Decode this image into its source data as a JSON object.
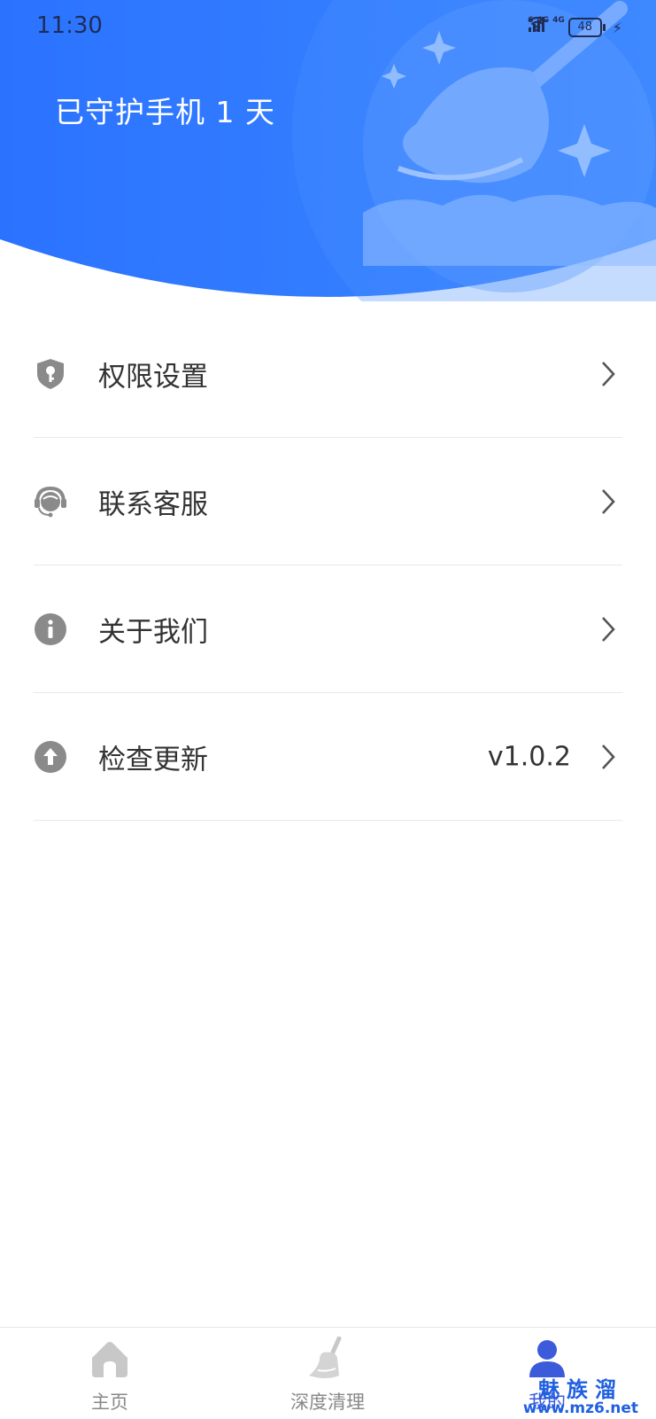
{
  "status_bar": {
    "time": "11:30",
    "wifi_label": "6",
    "signal1_label": "4G",
    "signal2_label": "4G",
    "battery": "48"
  },
  "header": {
    "guard_text": "已守护手机 1 天",
    "background_color": "#2f7bff"
  },
  "menu": {
    "items": [
      {
        "label": "权限设置",
        "icon": "shield-key-icon"
      },
      {
        "label": "联系客服",
        "icon": "headset-icon"
      },
      {
        "label": "关于我们",
        "icon": "info-icon"
      },
      {
        "label": "检查更新",
        "icon": "upload-icon",
        "value": "v1.0.2"
      }
    ]
  },
  "tabbar": {
    "tabs": [
      {
        "label": "主页",
        "icon": "home-icon",
        "active": false
      },
      {
        "label": "深度清理",
        "icon": "broom-icon",
        "active": false
      },
      {
        "label": "我的",
        "icon": "user-icon",
        "active": true
      }
    ],
    "active_color": "#3b5bdb"
  },
  "watermark": {
    "brand": "魅族溜",
    "url": "www.mz6.net"
  }
}
